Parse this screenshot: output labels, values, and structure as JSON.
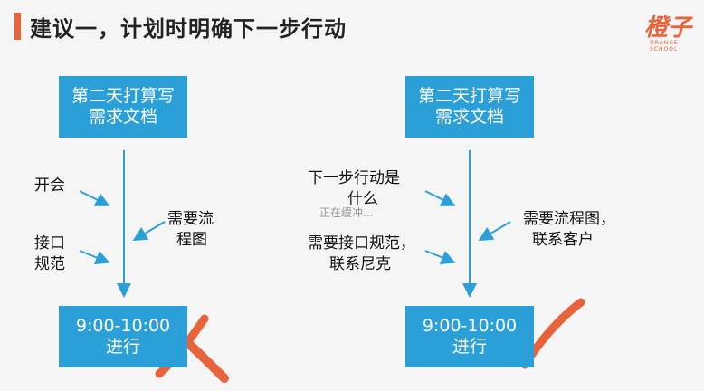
{
  "title": "建议一，计划时明确下一步行动",
  "logo": {
    "text": "橙子"
  },
  "left": {
    "top_box": [
      "第二天打算写",
      "需求文档"
    ],
    "label_meeting": "开会",
    "label_api": [
      "接口",
      "规范"
    ],
    "label_flow": [
      "需要流",
      "程图"
    ],
    "bottom_box": [
      "9:00-10:00",
      "进行"
    ],
    "mark": "cross"
  },
  "right": {
    "top_box": [
      "第二天打算写",
      "需求文档"
    ],
    "label_next": [
      "下一步行动是",
      "什么"
    ],
    "label_api": [
      "需要接口规范，",
      "联系尼克"
    ],
    "label_flow": [
      "需要流程图，",
      "联系客户"
    ],
    "bottom_box": [
      "9:00-10:00",
      "进行"
    ],
    "mark": "check",
    "overlay": "正在缓冲..."
  },
  "colors": {
    "accent": "#e8633a",
    "box": "#2a9fd8",
    "line": "#2a9fd8"
  }
}
